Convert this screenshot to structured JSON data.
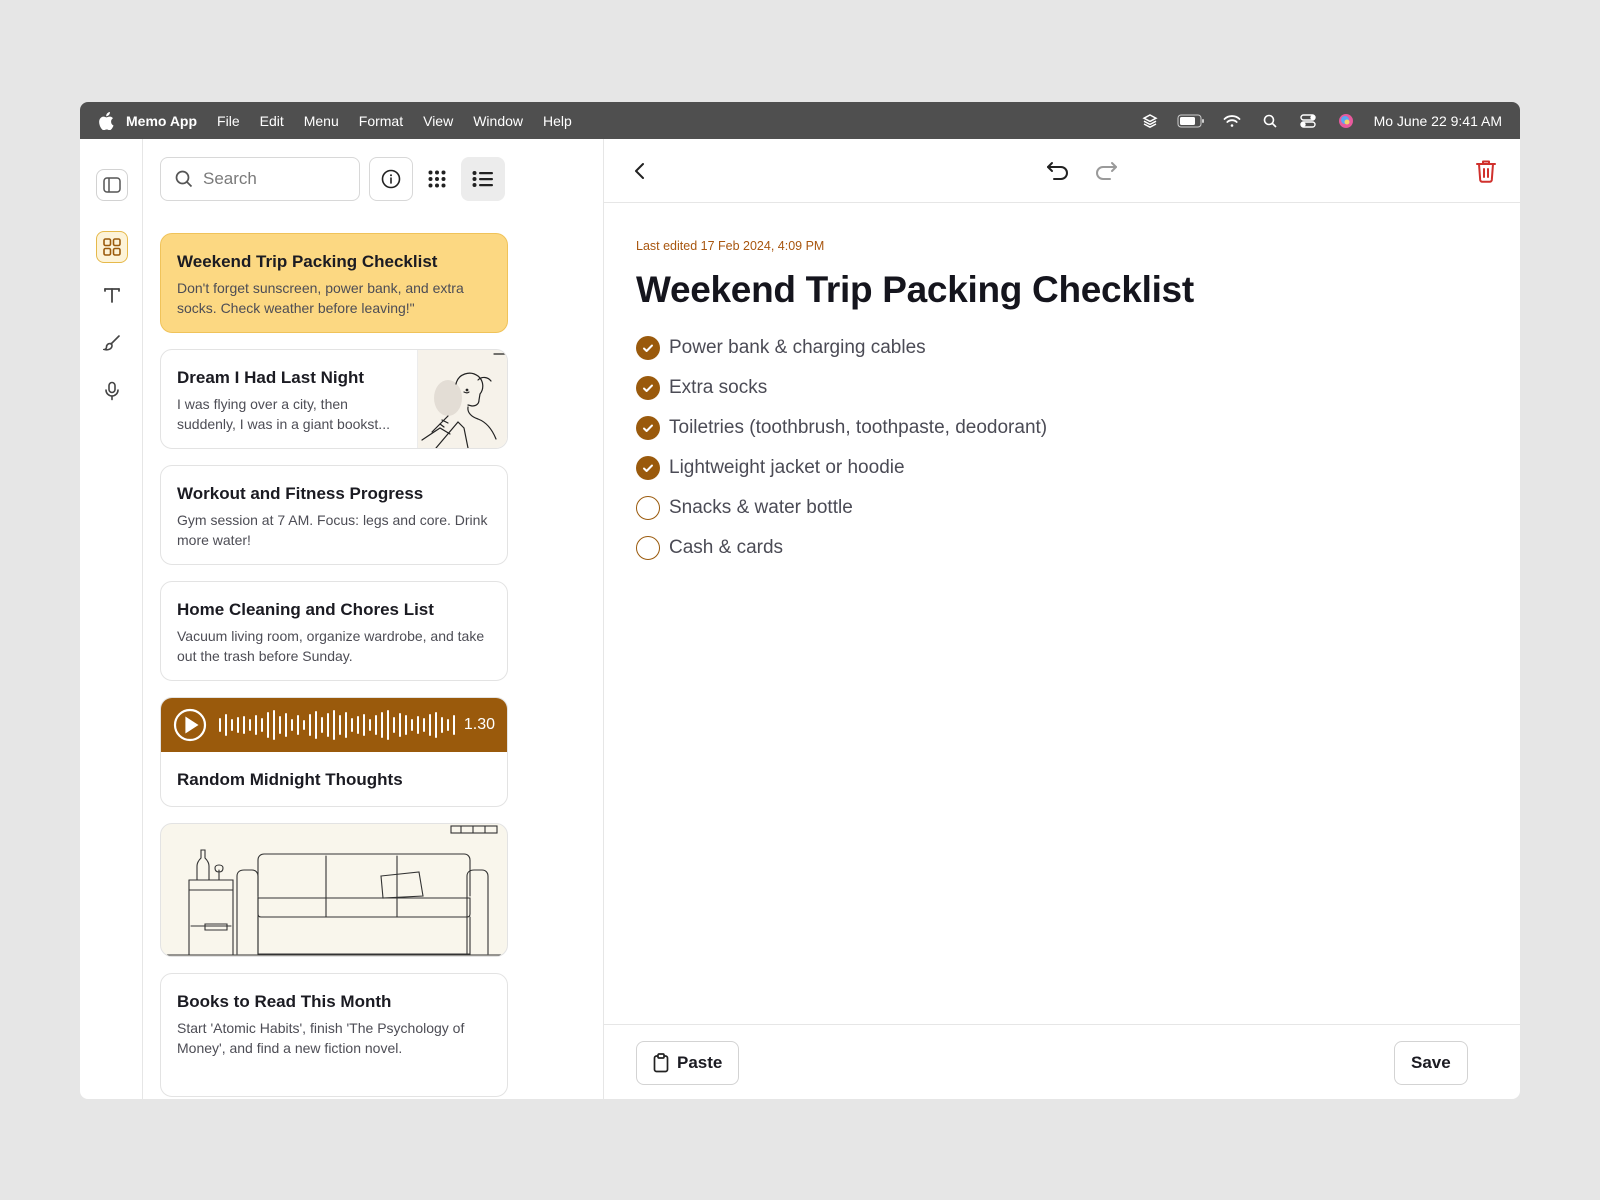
{
  "menubar": {
    "app_name": "Memo App",
    "menus": [
      "File",
      "Edit",
      "Menu",
      "Format",
      "View",
      "Window",
      "Help"
    ],
    "clock": "Mo June 22  9:41 AM"
  },
  "search": {
    "placeholder": "Search"
  },
  "notes": [
    {
      "title": "Weekend Trip Packing Checklist",
      "body": "Don't forget sunscreen, power bank, and extra socks. Check weather before leaving!\"",
      "active": true
    },
    {
      "title": "Dream I Had Last Night",
      "body": "I was flying over a city, then suddenly, I was in a giant bookst..."
    },
    {
      "title": "Workout and Fitness Progress",
      "body": "Gym session at 7 AM. Focus: legs and core. Drink more water!"
    },
    {
      "title": "Home Cleaning and Chores List",
      "body": "Vacuum living room, organize wardrobe, and take out the trash before Sunday."
    },
    {
      "title": "Random Midnight Thoughts",
      "audio_duration": "1.30"
    },
    {
      "title": "Books to Read This Month",
      "body": "Start 'Atomic Habits', finish 'The Psychology of Money', and find a new fiction novel."
    }
  ],
  "editor": {
    "last_edited": "Last edited 17 Feb 2024, 4:09 PM",
    "title": "Weekend Trip Packing Checklist",
    "checklist": [
      {
        "label": "Power bank & charging cables",
        "checked": true
      },
      {
        "label": "Extra socks",
        "checked": true
      },
      {
        "label": "Toiletries (toothbrush, toothpaste, deodorant)",
        "checked": true
      },
      {
        "label": "Lightweight jacket or hoodie",
        "checked": true
      },
      {
        "label": "Snacks & water bottle",
        "checked": false
      },
      {
        "label": "Cash & cards",
        "checked": false
      }
    ],
    "paste_label": "Paste",
    "save_label": "Save"
  },
  "icons": {
    "menubar": [
      "apple-icon",
      "layers-icon",
      "battery-icon",
      "wifi-icon",
      "search-icon",
      "control-center-icon",
      "siri-icon"
    ],
    "rail": [
      "sidebar-toggle-icon",
      "grid-icon",
      "text-icon",
      "brush-icon",
      "microphone-icon"
    ],
    "list_toolbar": [
      "search-icon",
      "info-icon",
      "grid-view-icon",
      "list-view-icon"
    ],
    "editor_toolbar": [
      "back-icon",
      "undo-icon",
      "redo-icon",
      "trash-icon",
      "clipboard-icon"
    ]
  },
  "colors": {
    "accent": "#9a5a0c",
    "active_card": "#fcd882",
    "danger": "#d0312d",
    "menubar": "#4f4f4f"
  }
}
